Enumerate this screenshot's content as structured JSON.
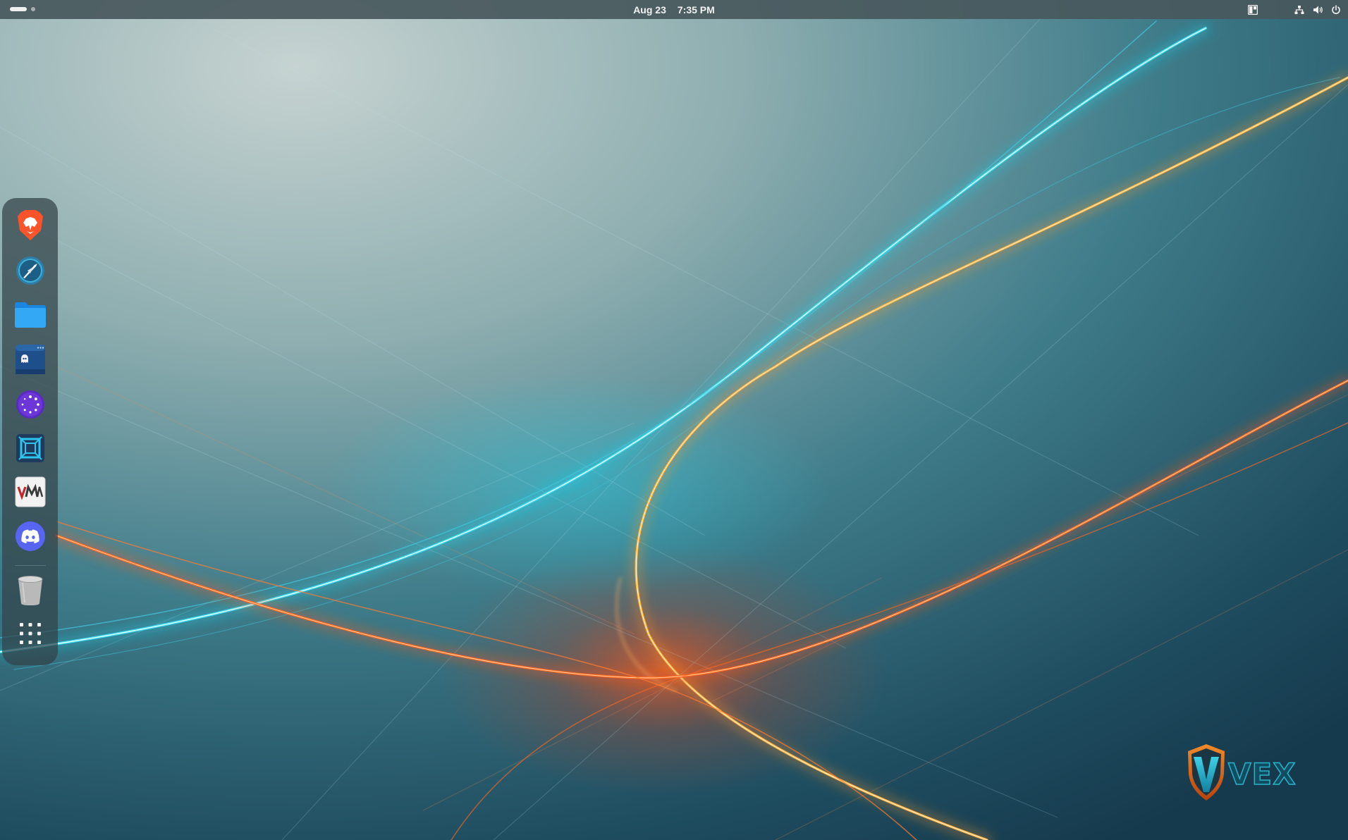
{
  "topbar": {
    "date": "Aug 23",
    "time": "7:35 PM",
    "workspaces": [
      {
        "active": true
      },
      {
        "active": false
      }
    ],
    "tray_icons": [
      "layout-icon",
      "network-icon",
      "volume-icon",
      "power-icon"
    ]
  },
  "dock": {
    "apps": [
      {
        "name": "brave-browser",
        "icon": "brave-lion-icon",
        "color": "#fb542b"
      },
      {
        "name": "vex-browser",
        "icon": "compass-icon",
        "color": "#3aa0c8"
      },
      {
        "name": "files",
        "icon": "folder-icon",
        "color": "#2b9bf0"
      },
      {
        "name": "ghost-terminal",
        "icon": "ghost-window-icon",
        "color": "#1e4c86"
      },
      {
        "name": "loader-app",
        "icon": "circle-dots-icon",
        "color": "#6a2fc9"
      },
      {
        "name": "window-tool",
        "icon": "frame-icon",
        "color": "#2ab0e0"
      },
      {
        "name": "virtual-machine-manager",
        "icon": "vm-icon",
        "color": "#c0272d"
      },
      {
        "name": "discord",
        "icon": "discord-icon",
        "color": "#5865f2"
      }
    ],
    "trash": {
      "icon": "trash-icon"
    },
    "app_grid": {
      "icon": "app-grid-icon"
    }
  },
  "branding": {
    "logo_text": "VEX",
    "colors": {
      "shield": "#e86a1c",
      "v": "#1fb2c9"
    }
  }
}
